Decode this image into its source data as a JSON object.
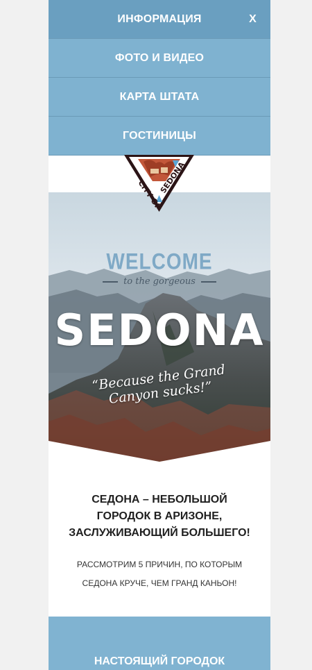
{
  "menu": {
    "items": [
      {
        "label": "ИНФОРМАЦИЯ"
      },
      {
        "label": "ФОТО И ВИДЕО"
      },
      {
        "label": "КАРТА ШТАТА"
      },
      {
        "label": "ГОСТИНИЦЫ"
      }
    ],
    "close_label": "X"
  },
  "logo": {
    "text": "CITY OF SEDONA"
  },
  "hero": {
    "welcome": "WELCOME",
    "subtitle": "to the gorgeous",
    "title": "SEDONA",
    "tagline": "“Because the Grand Canyon sucks!”"
  },
  "intro": {
    "heading": "СЕДОНА – НЕБОЛЬШОЙ ГОРОДОК В АРИЗОНЕ, ЗАСЛУЖИВАЮЩИЙ БОЛЬШЕГО!",
    "body": "РАССМОТРИМ 5 ПРИЧИН, ПО КОТОРЫМ СЕДОНА КРУЧЕ, ЧЕМ ГРАНД КАНЬОН!"
  },
  "section": {
    "label": "НАСТОЯЩИЙ ГОРОДОК"
  },
  "colors": {
    "menu_bg": "#7fb2d0",
    "menu_active": "#6a9fc0",
    "page_bg": "#f1f1f1",
    "accent_blue": "#7fa9c6"
  }
}
